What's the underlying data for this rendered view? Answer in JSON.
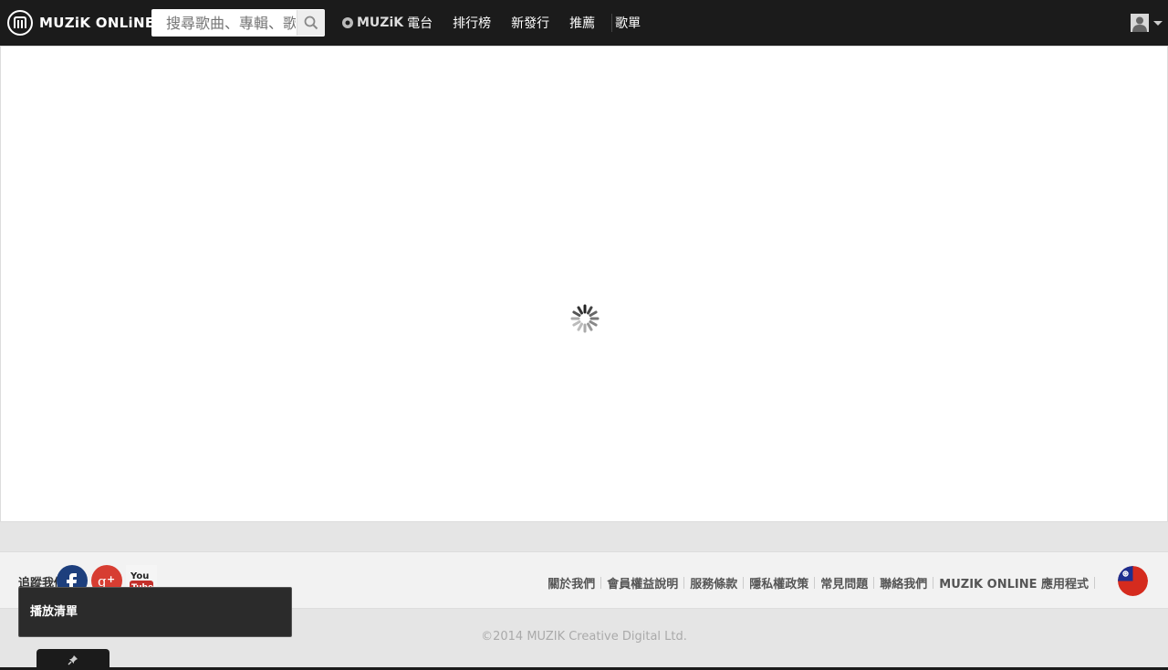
{
  "header": {
    "logo_text": "MUZiK ONLiNE",
    "search": {
      "placeholder": "搜尋歌曲、專輯、歌手、歌詞",
      "value": ""
    },
    "nav": [
      {
        "brand": "MUZiK",
        "suffix": "電台"
      },
      {
        "label": "排行榜"
      },
      {
        "label": "新發行"
      },
      {
        "label": "推薦"
      },
      {
        "label": "歌單"
      }
    ]
  },
  "content": {
    "state": "loading"
  },
  "footer": {
    "follow_label": "追蹤我們",
    "social": [
      "facebook-icon",
      "google-plus-icon",
      "youtube-icon"
    ],
    "links": [
      "關於我們",
      "會員權益說明",
      "服務條款",
      "隱私權政策",
      "常見問題",
      "聯絡我們",
      "MUZIK ONLINE 應用程式"
    ],
    "copyright": "©2014 MUZIK Creative Digital Ltd."
  },
  "popup": {
    "text": "播放清單"
  },
  "colors": {
    "topbar": "#1b1b1b",
    "background": "#e5e5e5",
    "footer": "#f2f2f2"
  }
}
